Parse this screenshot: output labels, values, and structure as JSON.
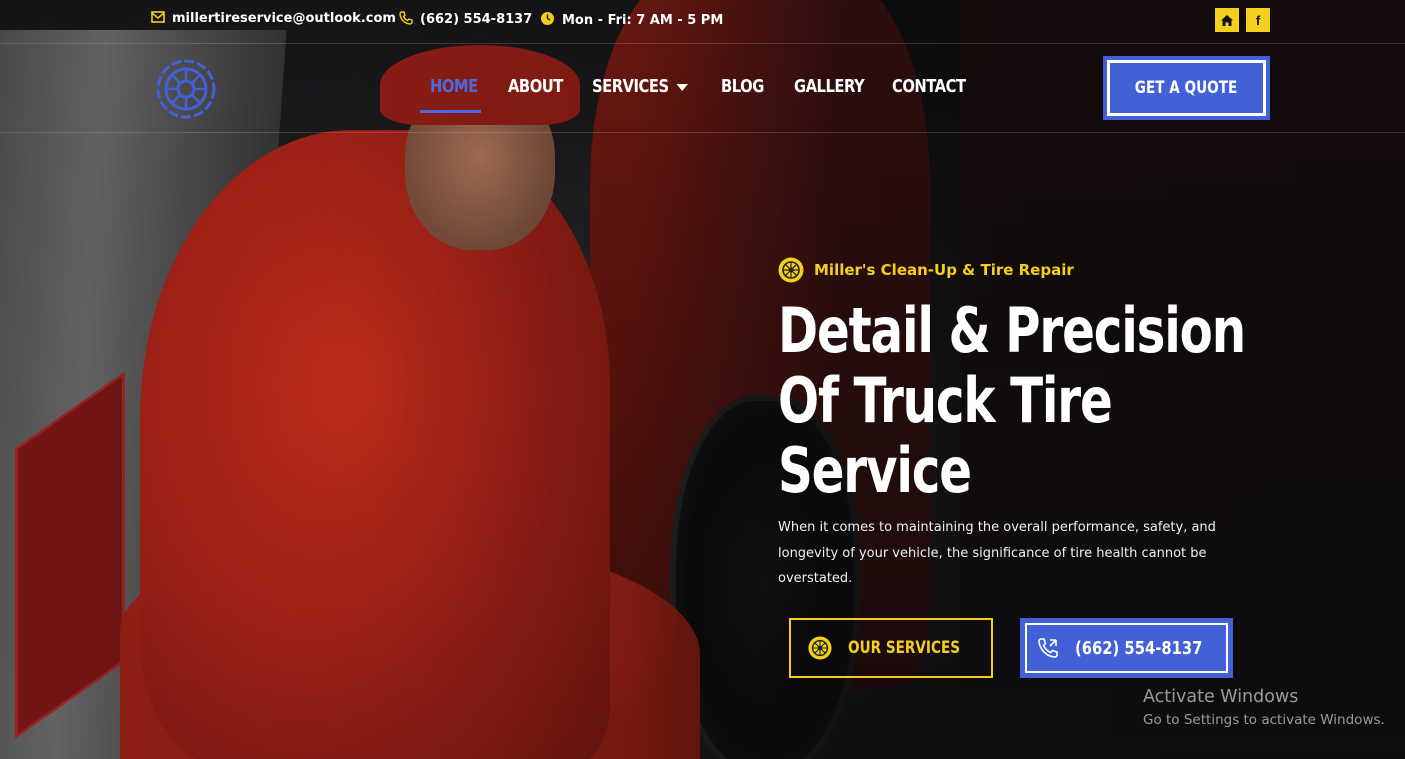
{
  "topbar": {
    "email": "millertireservice@outlook.com",
    "phone": "(662) 554-8137",
    "hours": "Mon - Fri: 7 AM - 5 PM",
    "email_icon": "envelope-icon",
    "phone_icon": "phone-icon",
    "hours_icon": "clock-icon",
    "social": [
      {
        "icon": "home-icon",
        "glyph": "⌂"
      },
      {
        "icon": "facebook-icon",
        "glyph": "f"
      }
    ]
  },
  "nav": {
    "logo_icon": "tire-logo-icon",
    "items": [
      {
        "label": "HOME",
        "active": true
      },
      {
        "label": "ABOUT",
        "active": false
      },
      {
        "label": "SERVICES",
        "active": false,
        "has_dropdown": true
      },
      {
        "label": "BLOG",
        "active": false
      },
      {
        "label": "GALLERY",
        "active": false
      },
      {
        "label": "CONTACT",
        "active": false
      }
    ],
    "quote_label": "GET A QUOTE"
  },
  "hero": {
    "eyebrow": "Miller's Clean-Up & Tire Repair",
    "headline_lines": [
      "Detail & Precision",
      "Of Truck Tire",
      "Service"
    ],
    "description": "When it comes to maintaining the overall performance, safety, and longevity of your vehicle, the significance of tire health cannot be overstated.",
    "services_button": "OUR SERVICES",
    "phone_button": "(662) 554-8137"
  },
  "watermark": {
    "title": "Activate Windows",
    "subtitle": "Go to Settings to activate Windows."
  },
  "colors": {
    "accent_yellow": "#f5cf1d",
    "accent_blue": "#4361d6",
    "nav_active": "#4c6ae0"
  }
}
